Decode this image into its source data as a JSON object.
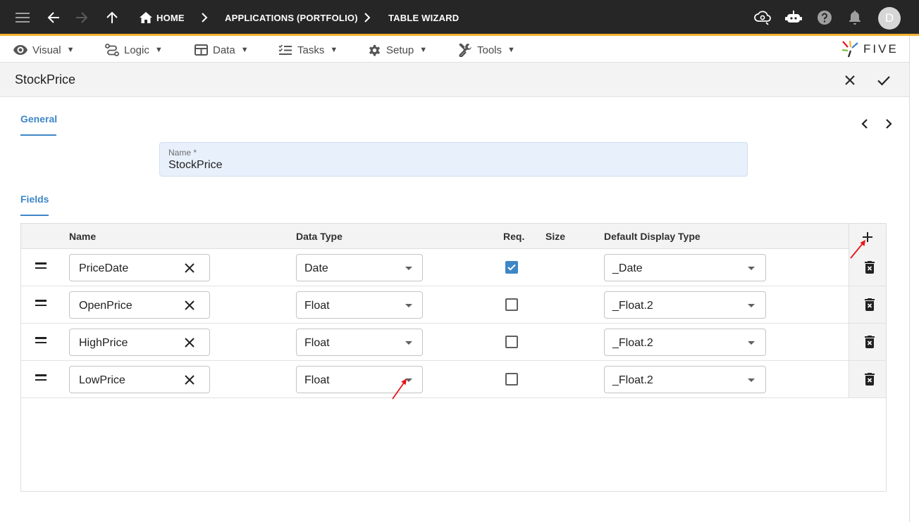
{
  "topbar": {
    "breadcrumbs": [
      "HOME",
      "APPLICATIONS (PORTFOLIO)",
      "TABLE WIZARD"
    ],
    "avatar_initial": "D",
    "bg_color": "#262626",
    "accent_color": "#f5b230"
  },
  "menubar": {
    "items": [
      "Visual",
      "Logic",
      "Data",
      "Tasks",
      "Setup",
      "Tools"
    ],
    "caret": "▼",
    "logo_text": "FIVE"
  },
  "form": {
    "title": "StockPrice",
    "general_tab": "General",
    "name_label": "Name *",
    "name_value": "StockPrice",
    "fields_tab": "Fields"
  },
  "grid": {
    "headers": {
      "name": "Name",
      "data_type": "Data Type",
      "req": "Req.",
      "size": "Size",
      "display_type": "Default Display Type"
    },
    "rows": [
      {
        "name": "PriceDate",
        "data_type": "Date",
        "required": true,
        "size": "",
        "display_type": "_Date"
      },
      {
        "name": "OpenPrice",
        "data_type": "Float",
        "required": false,
        "size": "",
        "display_type": "_Float.2"
      },
      {
        "name": "HighPrice",
        "data_type": "Float",
        "required": false,
        "size": "",
        "display_type": "_Float.2"
      },
      {
        "name": "LowPrice",
        "data_type": "Float",
        "required": false,
        "size": "",
        "display_type": "_Float.2"
      }
    ]
  },
  "colors": {
    "accent_blue": "#3d86c6",
    "annotation_red": "#e8141b"
  }
}
